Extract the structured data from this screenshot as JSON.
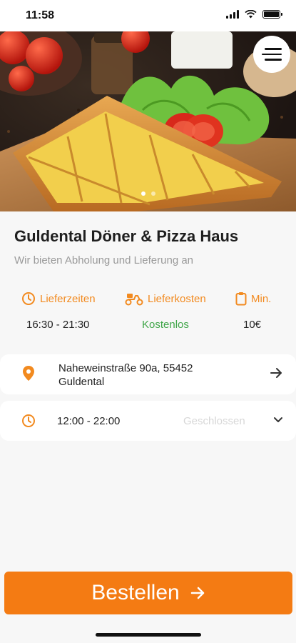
{
  "status_bar": {
    "time": "11:58"
  },
  "hero": {
    "slide_count": 2,
    "active_slide": 1
  },
  "restaurant": {
    "name": "Guldental Döner & Pizza Haus",
    "description": "Wir bieten Abholung und Lieferung an"
  },
  "info": {
    "delivery_times_label": "Lieferzeiten",
    "delivery_times_value": "16:30 - 21:30",
    "delivery_cost_label": "Lieferkosten",
    "delivery_cost_value": "Kostenlos",
    "min_label": "Min.",
    "min_value": "10€"
  },
  "address": {
    "text": "Naheweinstraße 90a, 55452 Guldental"
  },
  "hours": {
    "time": "12:00 - 22:00",
    "status": "Geschlossen"
  },
  "order_button": {
    "label": "Bestellen"
  },
  "colors": {
    "accent": "#f28a1f",
    "button": "#f47b13",
    "free_green": "#3fa548",
    "closed_grey": "#d7d7d7"
  }
}
